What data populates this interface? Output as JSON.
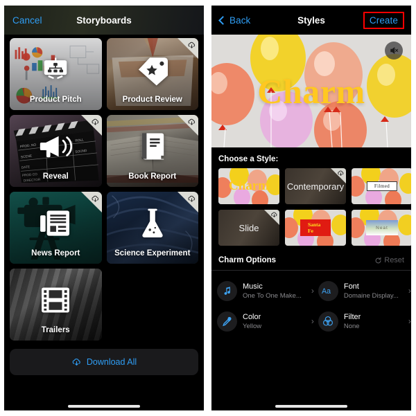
{
  "left_panel": {
    "nav": {
      "cancel_label": "Cancel",
      "title": "Storyboards"
    },
    "tiles": [
      {
        "label": "Product Pitch",
        "icon": "presentation-chart-icon",
        "has_download_badge": false
      },
      {
        "label": "Product Review",
        "icon": "tag-star-icon",
        "has_download_badge": true
      },
      {
        "label": "Reveal",
        "icon": "megaphone-icon",
        "has_download_badge": true
      },
      {
        "label": "Book Report",
        "icon": "book-icon",
        "has_download_badge": true
      },
      {
        "label": "News Report",
        "icon": "newspaper-icon",
        "has_download_badge": true
      },
      {
        "label": "Science Experiment",
        "icon": "flask-icon",
        "has_download_badge": true
      },
      {
        "label": "Trailers",
        "icon": "film-strip-icon",
        "has_download_badge": false
      }
    ],
    "download_all": {
      "label": "Download All",
      "icon": "cloud-download-icon"
    }
  },
  "right_panel": {
    "nav": {
      "back_label": "Back",
      "title": "Styles",
      "create_label": "Create",
      "create_highlight_color": "#ff0000"
    },
    "preview": {
      "style_title": "Charm",
      "title_color": "#ffc821",
      "mute_icon": "speaker-mute-icon"
    },
    "choose_style_label": "Choose a Style:",
    "styles": [
      {
        "name": "Charm",
        "display_kind": "charm",
        "selected": true,
        "has_download_badge": false
      },
      {
        "name": "Contemporary",
        "display_kind": "plain-dark",
        "selected": false,
        "has_download_badge": true
      },
      {
        "name": "Filmed",
        "display_kind": "label-chip",
        "selected": false,
        "has_download_badge": false
      },
      {
        "name": "Slide",
        "display_kind": "plain-dark",
        "selected": false,
        "has_download_badge": true
      },
      {
        "name": "Santa Fe",
        "display_kind": "santafe",
        "selected": false,
        "has_download_badge": false
      },
      {
        "name": "Neat",
        "display_kind": "neat",
        "selected": false,
        "has_download_badge": false
      }
    ],
    "options": {
      "title": "Charm Options",
      "reset_label": "Reset",
      "reset_icon": "reset-arrow-icon",
      "items": [
        {
          "title": "Music",
          "value": "One To One Make...",
          "icon": "music-note-icon"
        },
        {
          "title": "Font",
          "value": "Domaine Display...",
          "icon": "text-aa-icon"
        },
        {
          "title": "Color",
          "value": "Yellow",
          "icon": "eyedropper-icon"
        },
        {
          "title": "Filter",
          "value": "None",
          "icon": "filter-circles-icon"
        }
      ],
      "chevron": "›"
    }
  }
}
